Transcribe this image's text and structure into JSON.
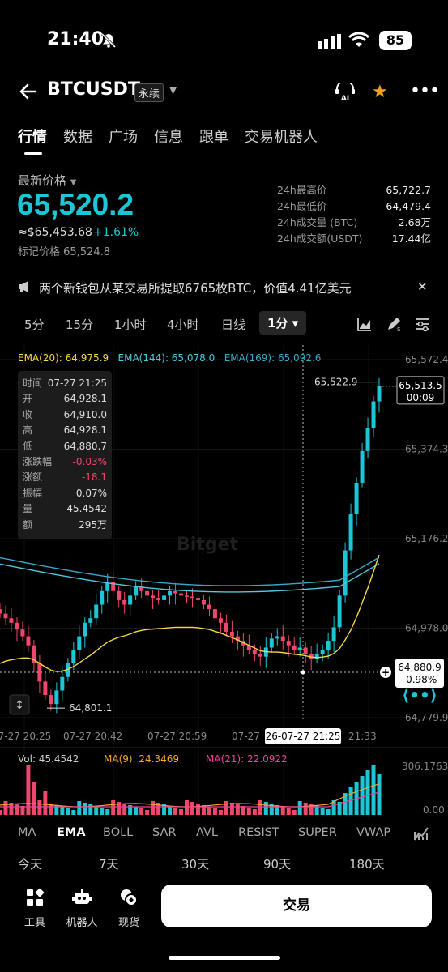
{
  "status": {
    "time": "21:40",
    "battery": "85"
  },
  "header": {
    "pair": "BTCUSDT",
    "badge": "永续"
  },
  "tabs": [
    "行情",
    "数据",
    "广场",
    "信息",
    "跟单",
    "交易机器人"
  ],
  "price": {
    "label": "最新价格",
    "last": "65,520.2",
    "usd": "≈$65,453.68",
    "change": "+1.61%",
    "mark": "标记价格 65,524.8"
  },
  "stats": [
    {
      "k": "24h最高价",
      "v": "65,722.7"
    },
    {
      "k": "24h最低价",
      "v": "64,479.4"
    },
    {
      "k": "24h成交量 (BTC)",
      "v": "2.68万"
    },
    {
      "k": "24h成交额(USDT)",
      "v": "17.44亿"
    }
  ],
  "news": "两个新钱包从某交易所提取6765枚BTC，价值4.41亿美元",
  "intervals": [
    "5分",
    "15分",
    "1小时",
    "4小时",
    "日线",
    "1分"
  ],
  "ema_legend": {
    "ema20": "EMA(20): 64,975.9",
    "ema144": "EMA(144): 65,078.0",
    "ema169": "EMA(169): 65,092.6"
  },
  "info_box": [
    {
      "k": "时间",
      "v": "07-27 21:25"
    },
    {
      "k": "开",
      "v": "64,928.1"
    },
    {
      "k": "收",
      "v": "64,910.0"
    },
    {
      "k": "高",
      "v": "64,928.1"
    },
    {
      "k": "低",
      "v": "64,880.7"
    },
    {
      "k": "涨跌幅",
      "v": "-0.03%",
      "red": true
    },
    {
      "k": "涨额",
      "v": "-18.1",
      "red": true
    },
    {
      "k": "振幅",
      "v": "0.07%"
    },
    {
      "k": "量",
      "v": "45.4542"
    },
    {
      "k": "额",
      "v": "295万"
    }
  ],
  "watermark": "Bitget",
  "chart_data": {
    "type": "candlestick",
    "price_axis": [
      "65,572.4",
      "65,374.3",
      "65,176.2",
      "64,978.0",
      "64,779.9"
    ],
    "ylim": [
      64779.9,
      65572.4
    ],
    "time_axis": [
      "07-27 20:25",
      "07-27 20:42",
      "07-27 20:59",
      "07-27 21:16",
      "07-27 21:33"
    ],
    "max_label": "65,522.9",
    "min_label": "64,801.1",
    "last_price_tag": {
      "price": "65,513.5",
      "countdown": "00:09"
    },
    "crosshair_tag": {
      "price": "64,880.9",
      "pct": "-0.98%"
    },
    "crosshair_time": "26-07-27 21:25",
    "closes": [
      65010,
      65000,
      64990,
      64975,
      64960,
      64940,
      64900,
      64860,
      64830,
      64810,
      64840,
      64870,
      64900,
      64930,
      64960,
      64990,
      65000,
      65030,
      65060,
      65080,
      65060,
      65040,
      65030,
      65050,
      65070,
      65060,
      65050,
      65045,
      65040,
      65050,
      65060,
      65055,
      65050,
      65048,
      65045,
      65040,
      65030,
      65020,
      65000,
      64990,
      64970,
      64960,
      64950,
      64940,
      64930,
      64920,
      64915,
      64935,
      64955,
      64960,
      64950,
      64940,
      64930,
      64935,
      64920,
      64910,
      64920,
      64930,
      64950,
      64980,
      65050,
      65150,
      65230,
      65300,
      65370,
      65420,
      65480,
      65513.5
    ],
    "ema20": [
      64900,
      64905,
      64908,
      64910,
      64912,
      64912,
      64908,
      64900,
      64892,
      64885,
      64882,
      64883,
      64887,
      64893,
      64901,
      64910,
      64918,
      64928,
      64938,
      64947,
      64953,
      64958,
      64961,
      64965,
      64970,
      64973,
      64975,
      64976,
      64977,
      64978,
      64979,
      64980,
      64980,
      64980,
      64980,
      64979,
      64977,
      64975,
      64971,
      64967,
      64962,
      64957,
      64952,
      64946,
      64940,
      64934,
      64928,
      64926,
      64925,
      64925,
      64924,
      64922,
      64920,
      64919,
      64917,
      64914,
      64913,
      64914,
      64916,
      64922,
      64933,
      64952,
      64974,
      65002,
      65034,
      65067,
      65103,
      65140
    ],
    "volume": {
      "label": "Vol: 45.4542",
      "ma9": "MA(9): 24.3469",
      "ma21": "MA(21): 22.0922",
      "axis_max": "306.1763",
      "axis_min": "0.00"
    }
  },
  "indicators": [
    "MA",
    "EMA",
    "BOLL",
    "SAR",
    "AVL",
    "RESIST",
    "SUPER",
    "VWAP"
  ],
  "performance": [
    "今天",
    "7天",
    "30天",
    "90天",
    "180天"
  ],
  "bottom_nav": [
    {
      "label": "工具",
      "icon": "tools-icon"
    },
    {
      "label": "机器人",
      "icon": "robot-icon"
    },
    {
      "label": "现货",
      "icon": "spot-icon"
    }
  ],
  "trade_button": "交易",
  "colors": {
    "up": "#1cc6d6",
    "down": "#f0466b",
    "ema20": "#f5d742",
    "ema144": "#4ec9e0",
    "ema169": "#3aa7c9"
  }
}
